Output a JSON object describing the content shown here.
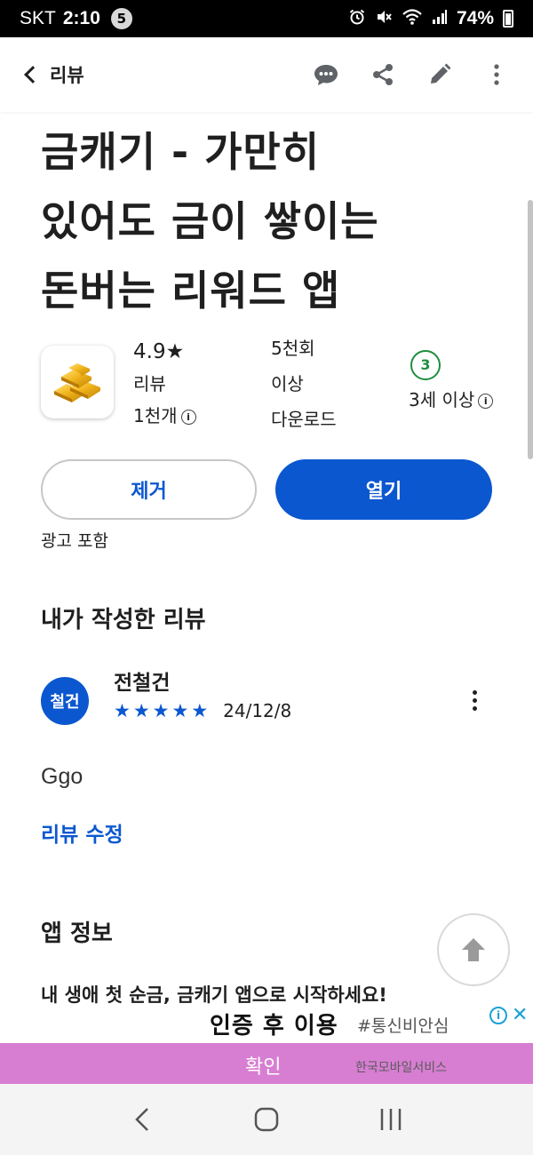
{
  "status_bar": {
    "carrier": "SKT",
    "time": "2:10",
    "notification_count": "5",
    "battery": "74%"
  },
  "app_bar": {
    "back_label": "리뷰",
    "actions": [
      "chat-icon",
      "share-icon",
      "edit-icon",
      "more-vert-icon"
    ]
  },
  "app": {
    "title": "금캐기 - 가만히 있어도 금이 쌓이는 돈버는 리워드 앱",
    "title_lines": [
      "금캐기 - 가만히",
      "있어도 금이 쌓이는",
      "돈버는 리워드 앱"
    ],
    "rating": "4.9★",
    "reviews_label": "리뷰",
    "reviews_count": "1천개",
    "downloads_line1": "5천회",
    "downloads_line2": "이상",
    "downloads_label": "다운로드",
    "age_badge": "3",
    "age_label": "3세 이상",
    "remove_button": "제거",
    "open_button": "열기",
    "contains_ads": "광고 포함"
  },
  "my_review": {
    "section_title": "내가 작성한 리뷰",
    "avatar_text": "철건",
    "reviewer_name": "전철건",
    "stars": 5,
    "date": "24/12/8",
    "text": "Ggo",
    "edit_link": "리뷰 수정"
  },
  "app_info": {
    "section_title": "앱 정보",
    "description": "내 생애 첫 순금, 금캐기 앱으로 시작하세요!"
  },
  "ad_banner": {
    "headline": "인증 후 이용",
    "hashtag": "#통신비안심",
    "confirm_button": "확인",
    "sponsor": "한국모바일서비스"
  },
  "colors": {
    "accent": "#0b57d0",
    "age_green": "#1e8e3e",
    "ad_pink": "#d77ed2"
  }
}
